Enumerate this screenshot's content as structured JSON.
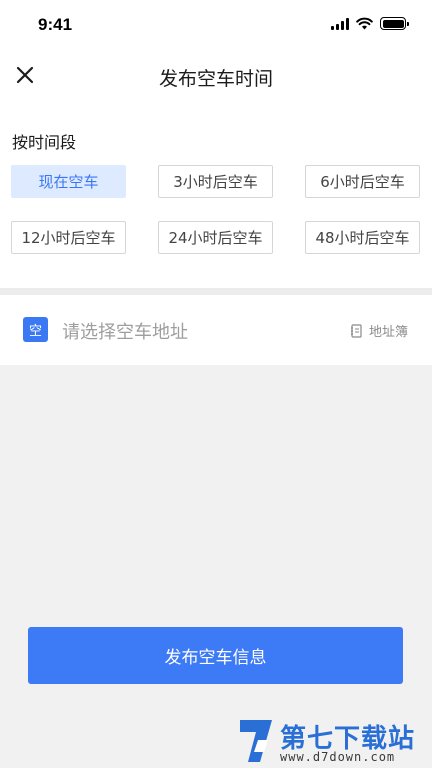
{
  "status_bar": {
    "time": "9:41",
    "icons": [
      "signal-icon",
      "wifi-icon",
      "battery-icon"
    ]
  },
  "header": {
    "close_icon": "close-icon",
    "title": "发布空车时间"
  },
  "time_section": {
    "label": "按时间段",
    "selected": "现在空车",
    "options": [
      "现在空车",
      "3小时后空车",
      "6小时后空车",
      "12小时后空车",
      "24小时后空车",
      "48小时后空车"
    ]
  },
  "address": {
    "badge": "空",
    "placeholder": "请选择空车地址",
    "book_icon": "address-book-icon",
    "book_label": "地址簿"
  },
  "publish_button": "发布空车信息",
  "watermark": {
    "name": "第七下载站",
    "url": "www.d7down.com"
  },
  "colors": {
    "accent": "#3d7af5",
    "selected_bg": "#deeaff",
    "selected_text": "#3977f4",
    "page_bg": "#f1f1f1"
  }
}
